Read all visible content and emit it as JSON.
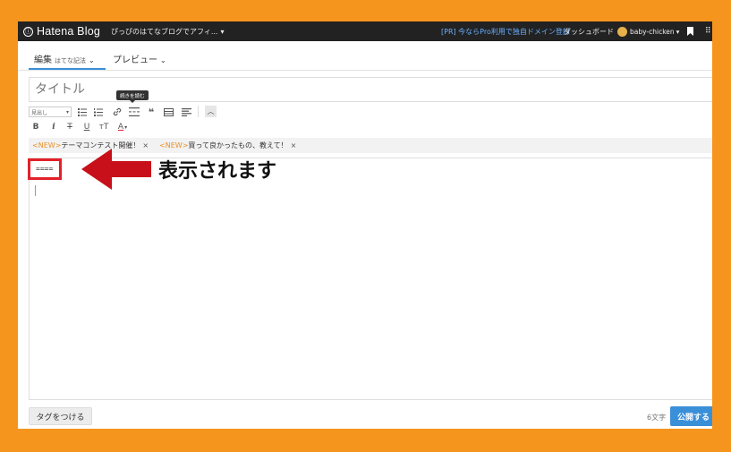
{
  "topbar": {
    "logo_text": "Hatena Blog",
    "blog_title": "ぴっぴのはてなブログでアフィ...",
    "blog_title_caret": "▾",
    "pr_link": "[PR] 今ならPro利用で独自ドメイン登録",
    "dashboard": "ダッシュボード",
    "username": "baby-chicken",
    "user_caret": "▾"
  },
  "tabs": {
    "edit_label": "編集",
    "edit_mode": "はてな記法",
    "preview_label": "プレビュー",
    "chevron": "⌄"
  },
  "title_placeholder": "タイトル",
  "toolbar": {
    "heading_select": "見出し",
    "tooltip": "続きを読む",
    "bold": "B",
    "italic": "i",
    "strike": "T",
    "underline": "U",
    "font_size": "тT",
    "color": "A",
    "collapse": "︿",
    "quote": "❝"
  },
  "tags": [
    {
      "new": "<NEW>",
      "text": "テーマコンテスト開催！",
      "close": "×"
    },
    {
      "new": "<NEW>",
      "text": "買って良かったもの、教えて！",
      "close": "×"
    }
  ],
  "editor": {
    "content": "===="
  },
  "annotation": {
    "text": "表示されます",
    "highlight_color": "#e3202a",
    "arrow_color": "#c8101a"
  },
  "footer": {
    "tag_button": "タグをつける",
    "char_count": "6文字",
    "publish_button": "公開する"
  },
  "colors": {
    "frame": "#f5951d",
    "topbar": "#222222",
    "accent": "#3a8fd9"
  }
}
